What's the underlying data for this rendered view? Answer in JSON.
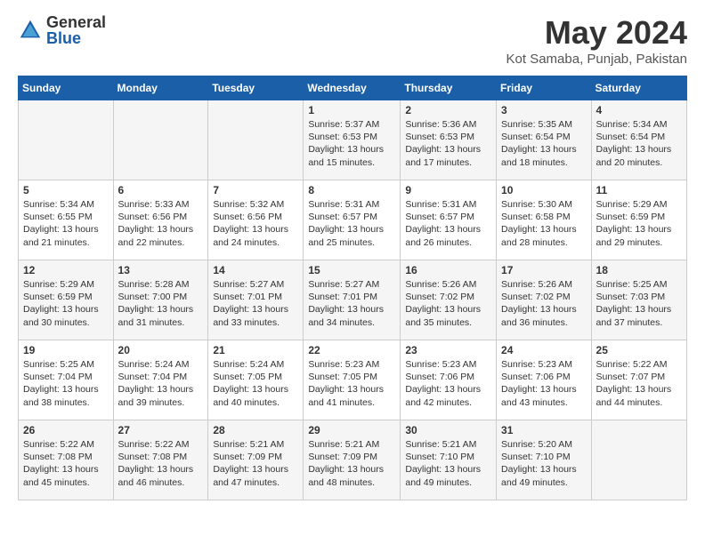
{
  "logo": {
    "general": "General",
    "blue": "Blue"
  },
  "title": "May 2024",
  "location": "Kot Samaba, Punjab, Pakistan",
  "days_of_week": [
    "Sunday",
    "Monday",
    "Tuesday",
    "Wednesday",
    "Thursday",
    "Friday",
    "Saturday"
  ],
  "weeks": [
    [
      {
        "day": "",
        "info": ""
      },
      {
        "day": "",
        "info": ""
      },
      {
        "day": "",
        "info": ""
      },
      {
        "day": "1",
        "info": "Sunrise: 5:37 AM\nSunset: 6:53 PM\nDaylight: 13 hours and 15 minutes."
      },
      {
        "day": "2",
        "info": "Sunrise: 5:36 AM\nSunset: 6:53 PM\nDaylight: 13 hours and 17 minutes."
      },
      {
        "day": "3",
        "info": "Sunrise: 5:35 AM\nSunset: 6:54 PM\nDaylight: 13 hours and 18 minutes."
      },
      {
        "day": "4",
        "info": "Sunrise: 5:34 AM\nSunset: 6:54 PM\nDaylight: 13 hours and 20 minutes."
      }
    ],
    [
      {
        "day": "5",
        "info": "Sunrise: 5:34 AM\nSunset: 6:55 PM\nDaylight: 13 hours and 21 minutes."
      },
      {
        "day": "6",
        "info": "Sunrise: 5:33 AM\nSunset: 6:56 PM\nDaylight: 13 hours and 22 minutes."
      },
      {
        "day": "7",
        "info": "Sunrise: 5:32 AM\nSunset: 6:56 PM\nDaylight: 13 hours and 24 minutes."
      },
      {
        "day": "8",
        "info": "Sunrise: 5:31 AM\nSunset: 6:57 PM\nDaylight: 13 hours and 25 minutes."
      },
      {
        "day": "9",
        "info": "Sunrise: 5:31 AM\nSunset: 6:57 PM\nDaylight: 13 hours and 26 minutes."
      },
      {
        "day": "10",
        "info": "Sunrise: 5:30 AM\nSunset: 6:58 PM\nDaylight: 13 hours and 28 minutes."
      },
      {
        "day": "11",
        "info": "Sunrise: 5:29 AM\nSunset: 6:59 PM\nDaylight: 13 hours and 29 minutes."
      }
    ],
    [
      {
        "day": "12",
        "info": "Sunrise: 5:29 AM\nSunset: 6:59 PM\nDaylight: 13 hours and 30 minutes."
      },
      {
        "day": "13",
        "info": "Sunrise: 5:28 AM\nSunset: 7:00 PM\nDaylight: 13 hours and 31 minutes."
      },
      {
        "day": "14",
        "info": "Sunrise: 5:27 AM\nSunset: 7:01 PM\nDaylight: 13 hours and 33 minutes."
      },
      {
        "day": "15",
        "info": "Sunrise: 5:27 AM\nSunset: 7:01 PM\nDaylight: 13 hours and 34 minutes."
      },
      {
        "day": "16",
        "info": "Sunrise: 5:26 AM\nSunset: 7:02 PM\nDaylight: 13 hours and 35 minutes."
      },
      {
        "day": "17",
        "info": "Sunrise: 5:26 AM\nSunset: 7:02 PM\nDaylight: 13 hours and 36 minutes."
      },
      {
        "day": "18",
        "info": "Sunrise: 5:25 AM\nSunset: 7:03 PM\nDaylight: 13 hours and 37 minutes."
      }
    ],
    [
      {
        "day": "19",
        "info": "Sunrise: 5:25 AM\nSunset: 7:04 PM\nDaylight: 13 hours and 38 minutes."
      },
      {
        "day": "20",
        "info": "Sunrise: 5:24 AM\nSunset: 7:04 PM\nDaylight: 13 hours and 39 minutes."
      },
      {
        "day": "21",
        "info": "Sunrise: 5:24 AM\nSunset: 7:05 PM\nDaylight: 13 hours and 40 minutes."
      },
      {
        "day": "22",
        "info": "Sunrise: 5:23 AM\nSunset: 7:05 PM\nDaylight: 13 hours and 41 minutes."
      },
      {
        "day": "23",
        "info": "Sunrise: 5:23 AM\nSunset: 7:06 PM\nDaylight: 13 hours and 42 minutes."
      },
      {
        "day": "24",
        "info": "Sunrise: 5:23 AM\nSunset: 7:06 PM\nDaylight: 13 hours and 43 minutes."
      },
      {
        "day": "25",
        "info": "Sunrise: 5:22 AM\nSunset: 7:07 PM\nDaylight: 13 hours and 44 minutes."
      }
    ],
    [
      {
        "day": "26",
        "info": "Sunrise: 5:22 AM\nSunset: 7:08 PM\nDaylight: 13 hours and 45 minutes."
      },
      {
        "day": "27",
        "info": "Sunrise: 5:22 AM\nSunset: 7:08 PM\nDaylight: 13 hours and 46 minutes."
      },
      {
        "day": "28",
        "info": "Sunrise: 5:21 AM\nSunset: 7:09 PM\nDaylight: 13 hours and 47 minutes."
      },
      {
        "day": "29",
        "info": "Sunrise: 5:21 AM\nSunset: 7:09 PM\nDaylight: 13 hours and 48 minutes."
      },
      {
        "day": "30",
        "info": "Sunrise: 5:21 AM\nSunset: 7:10 PM\nDaylight: 13 hours and 49 minutes."
      },
      {
        "day": "31",
        "info": "Sunrise: 5:20 AM\nSunset: 7:10 PM\nDaylight: 13 hours and 49 minutes."
      },
      {
        "day": "",
        "info": ""
      }
    ]
  ]
}
